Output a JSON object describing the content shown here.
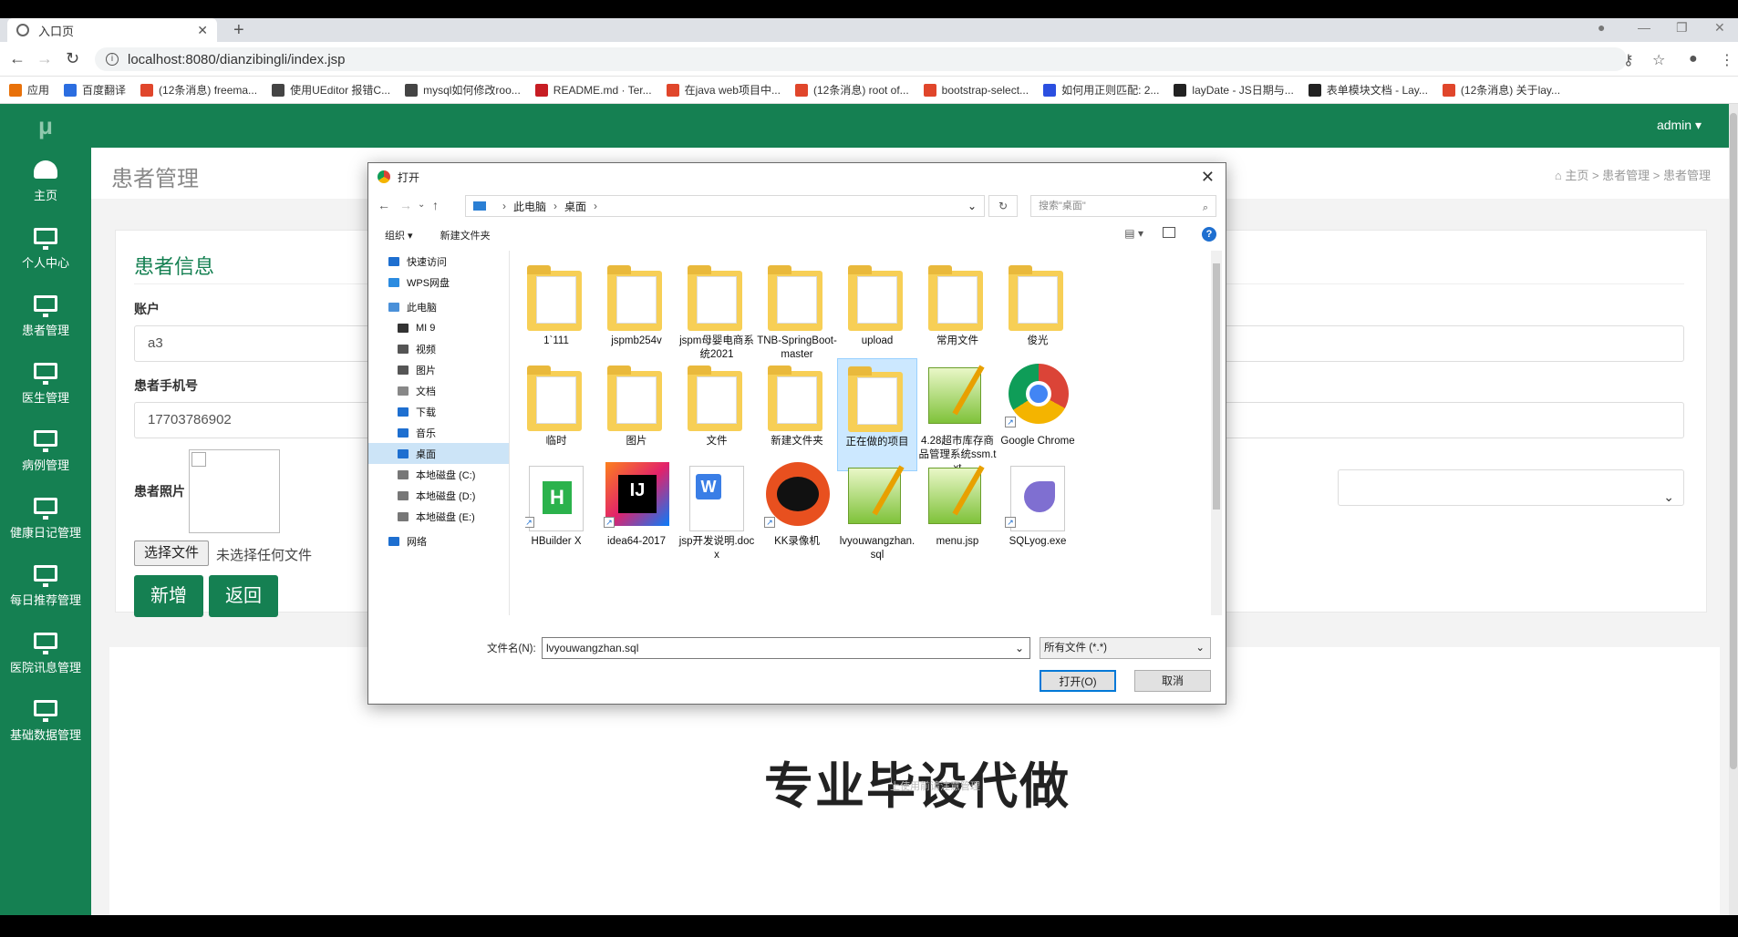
{
  "browser": {
    "tab_title": "入口页",
    "url": "localhost:8080/dianzibingli/index.jsp",
    "bookmarks": [
      {
        "label": "应用",
        "color": "#e8710a"
      },
      {
        "label": "百度翻译",
        "color": "#2b6de0"
      },
      {
        "label": "(12条消息) freema...",
        "color": "#e0462b"
      },
      {
        "label": "使用UEditor 报错C...",
        "color": "#444444"
      },
      {
        "label": "mysql如何修改roo...",
        "color": "#444444"
      },
      {
        "label": "README.md · Ter...",
        "color": "#c71d23"
      },
      {
        "label": "在java web项目中...",
        "color": "#e0462b"
      },
      {
        "label": "(12条消息) root of...",
        "color": "#e0462b"
      },
      {
        "label": "bootstrap-select...",
        "color": "#e0462b"
      },
      {
        "label": "如何用正则匹配: 2...",
        "color": "#2b4fe0"
      },
      {
        "label": "layDate - JS日期与...",
        "color": "#222222"
      },
      {
        "label": "表单模块文档 - Lay...",
        "color": "#222222"
      },
      {
        "label": "(12条消息) 关于lay...",
        "color": "#e0462b"
      }
    ]
  },
  "app": {
    "logo": "μ",
    "user": "admin ▾",
    "sidebar": [
      {
        "label": "主页",
        "icon": "dashboard-icon"
      },
      {
        "label": "个人中心",
        "icon": "monitor-icon"
      },
      {
        "label": "患者管理",
        "icon": "monitor-icon"
      },
      {
        "label": "医生管理",
        "icon": "monitor-icon"
      },
      {
        "label": "病例管理",
        "icon": "monitor-icon"
      },
      {
        "label": "健康日记管理",
        "icon": "monitor-icon"
      },
      {
        "label": "每日推荐管理",
        "icon": "monitor-icon"
      },
      {
        "label": "医院讯息管理",
        "icon": "monitor-icon"
      },
      {
        "label": "基础数据管理",
        "icon": "monitor-icon"
      }
    ],
    "page_title": "患者管理",
    "breadcrumb": "主页  >  患者管理  >  患者管理",
    "card_title": "患者信息",
    "fields": {
      "account_label": "账户",
      "account_value": "a3",
      "phone_label": "患者手机号",
      "phone_value": "17703786902",
      "photo_label": "患者照片",
      "file_button": "选择文件",
      "file_status": "未选择任何文件"
    },
    "buttons": {
      "add": "新增",
      "back": "返回"
    },
    "watermark": "专业毕设代做",
    "watermark_small": "上使用前请注意管理"
  },
  "dialog": {
    "title": "打开",
    "path": [
      "此电脑",
      "桌面"
    ],
    "search_placeholder": "搜索\"桌面\"",
    "toolbar": {
      "organize": "组织 ▾",
      "new_folder": "新建文件夹"
    },
    "tree": [
      {
        "label": "快速访问",
        "color": "#1e6fd0",
        "sel": false
      },
      {
        "label": "WPS网盘",
        "color": "#2b8be0",
        "sel": false
      },
      {
        "label": "此电脑",
        "color": "#4a90d9",
        "sel": false
      },
      {
        "label": "MI 9",
        "color": "#333333",
        "sel": false
      },
      {
        "label": "视频",
        "color": "#555555",
        "sel": false
      },
      {
        "label": "图片",
        "color": "#555555",
        "sel": false
      },
      {
        "label": "文档",
        "color": "#888888",
        "sel": false
      },
      {
        "label": "下载",
        "color": "#1e6fd0",
        "sel": false
      },
      {
        "label": "音乐",
        "color": "#1e6fd0",
        "sel": false
      },
      {
        "label": "桌面",
        "color": "#1e6fd0",
        "sel": true
      },
      {
        "label": "本地磁盘 (C:)",
        "color": "#777777",
        "sel": false
      },
      {
        "label": "本地磁盘 (D:)",
        "color": "#777777",
        "sel": false
      },
      {
        "label": "本地磁盘 (E:)",
        "color": "#777777",
        "sel": false
      },
      {
        "label": "网络",
        "color": "#1e6fd0",
        "sel": false
      }
    ],
    "items": [
      {
        "label": "1`111",
        "kind": "folder"
      },
      {
        "label": "jspmb254v",
        "kind": "folder"
      },
      {
        "label": "jspm母婴电商系统2021",
        "kind": "folder"
      },
      {
        "label": "TNB-SpringBoot-master",
        "kind": "folder"
      },
      {
        "label": "upload",
        "kind": "folder"
      },
      {
        "label": "常用文件",
        "kind": "folder"
      },
      {
        "label": "俊光",
        "kind": "folder"
      },
      {
        "label": "临时",
        "kind": "folder"
      },
      {
        "label": "图片",
        "kind": "folder"
      },
      {
        "label": "文件",
        "kind": "folder"
      },
      {
        "label": "新建文件夹",
        "kind": "folder"
      },
      {
        "label": "正在做的项目",
        "kind": "folder"
      },
      {
        "label": "4.28超市库存商品管理系统ssm.txt",
        "kind": "notepad"
      },
      {
        "label": "Google Chrome",
        "kind": "chrome"
      },
      {
        "label": "HBuilder X",
        "kind": "hbuilder"
      },
      {
        "label": "idea64-2017",
        "kind": "idea"
      },
      {
        "label": "jsp开发说明.docx",
        "kind": "doc"
      },
      {
        "label": "KK录像机",
        "kind": "kk"
      },
      {
        "label": "lvyouwangzhan.sql",
        "kind": "notepad"
      },
      {
        "label": "menu.jsp",
        "kind": "notepad"
      },
      {
        "label": "SQLyog.exe",
        "kind": "sqlyog"
      }
    ],
    "filename_label": "文件名(N):",
    "filename_value": "lvyouwangzhan.sql",
    "filetype": "所有文件 (*.*)",
    "open_button": "打开(O)",
    "cancel_button": "取消"
  }
}
